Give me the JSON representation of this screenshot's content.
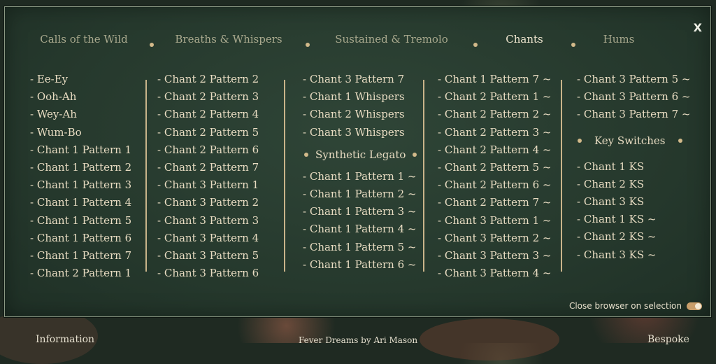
{
  "window": {
    "close_label": "X"
  },
  "tabs": [
    {
      "label": "Calls of the Wild",
      "active": false
    },
    {
      "label": "Breaths & Whispers",
      "active": false
    },
    {
      "label": "Sustained & Tremolo",
      "active": false
    },
    {
      "label": "Chants",
      "active": true
    },
    {
      "label": "Hums",
      "active": false
    }
  ],
  "columns": {
    "col1": [
      "- Ee-Ey",
      "- Ooh-Ah",
      "- Wey-Ah",
      "- Wum-Bo",
      "- Chant 1 Pattern 1",
      "- Chant 1 Pattern 2",
      "- Chant 1 Pattern 3",
      "- Chant 1 Pattern 4",
      "- Chant 1 Pattern 5",
      "- Chant 1 Pattern 6",
      "- Chant 1 Pattern 7",
      "- Chant 2 Pattern 1"
    ],
    "col2": [
      "- Chant 2 Pattern 2",
      "- Chant 2 Pattern 3",
      "- Chant 2 Pattern 4",
      "- Chant 2 Pattern 5",
      "- Chant 2 Pattern 6",
      "- Chant 2 Pattern 7",
      "- Chant 3 Pattern 1",
      "- Chant 3 Pattern 2",
      "- Chant 3 Pattern 3",
      "- Chant 3 Pattern 4",
      "- Chant 3 Pattern 5",
      "- Chant 3 Pattern 6"
    ],
    "col3_top": [
      "- Chant 3 Pattern 7",
      "- Chant 1 Whispers",
      "- Chant 2 Whispers",
      "- Chant 3 Whispers"
    ],
    "col3_section": "Synthetic Legato",
    "col3_bottom": [
      "- Chant 1 Pattern 1 ~",
      "- Chant 1 Pattern 2 ~",
      "- Chant 1 Pattern 3 ~",
      "- Chant 1 Pattern 4 ~",
      "- Chant 1 Pattern 5 ~",
      "- Chant 1 Pattern 6 ~"
    ],
    "col4": [
      "- Chant 1 Pattern 7 ~",
      "- Chant 2 Pattern 1 ~",
      "- Chant 2 Pattern 2 ~",
      "- Chant 2 Pattern 3 ~",
      "- Chant 2 Pattern 4 ~",
      "- Chant 2 Pattern 5 ~",
      "- Chant 2 Pattern 6 ~",
      "- Chant 2 Pattern 7 ~",
      "- Chant 3 Pattern 1 ~",
      "- Chant 3 Pattern 2 ~",
      "- Chant 3 Pattern 3 ~",
      "- Chant 3 Pattern 4 ~"
    ],
    "col5_top": [
      "- Chant 3 Pattern 5 ~",
      "- Chant 3 Pattern 6 ~",
      "- Chant 3 Pattern 7 ~"
    ],
    "col5_section": "Key Switches",
    "col5_bottom": [
      "- Chant 1 KS",
      "- Chant 2 KS",
      "- Chant 3 KS",
      "- Chant 1 KS ~",
      "- Chant 2 KS ~",
      "- Chant 3 KS ~"
    ]
  },
  "options": {
    "close_on_selection_label": "Close browser on selection",
    "close_on_selection": true
  },
  "footer": {
    "left": "Information",
    "center": "Fever Dreams by Ari Mason",
    "right": "Bespoke"
  },
  "colors": {
    "panel": "#26392d",
    "accent": "#d2b98a",
    "text": "#e8dcc2",
    "toggle": "#c99e6a"
  }
}
